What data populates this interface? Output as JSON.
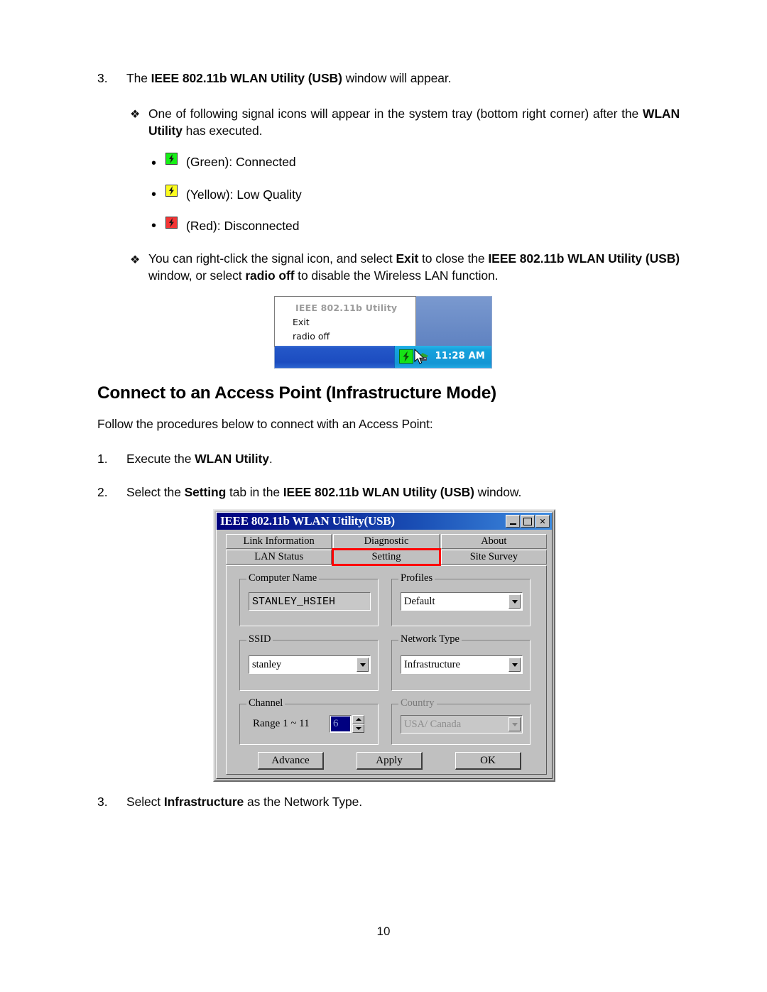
{
  "document": {
    "page_number": "10",
    "step3_top": {
      "number": "3.",
      "text_before": "The ",
      "bold": "IEEE 802.11b WLAN Utility (USB)",
      "text_after": " window will appear."
    },
    "bullet_signal_icons": {
      "marker": "❖",
      "line1_a": "One of following signal icons will appear in the system tray (bottom right corner) after the ",
      "line1_bold": "WLAN Utility",
      "line1_b": " has executed."
    },
    "signal_icons": [
      {
        "marker": "•",
        "icon": "signal-green-icon",
        "color": "#16ef16",
        "label": "(Green): Connected"
      },
      {
        "marker": "•",
        "icon": "signal-yellow-icon",
        "color": "#fcfc1e",
        "label": "(Yellow): Low Quality"
      },
      {
        "marker": "•",
        "icon": "signal-red-icon",
        "color": "#f43535",
        "label": "(Red): Disconnected"
      }
    ],
    "bullet_rightclick": {
      "marker": "❖",
      "a": "You can right-click the signal icon, and select ",
      "b1": "Exit",
      "b": " to close the ",
      "b2": "IEEE 802.11b WLAN Utility (USB)",
      "c": " window, or select ",
      "b3": "radio off",
      "d": " to disable the Wireless LAN function."
    },
    "heading": "Connect to an Access Point (Infrastructure Mode)",
    "intro": "Follow the procedures below to connect with an Access Point:",
    "steps": [
      {
        "number": "1.",
        "a": "Execute the ",
        "bold": "WLAN Utility",
        "b": "."
      },
      {
        "number": "2.",
        "a": "Select the ",
        "bold": "Setting",
        "b": " tab in the ",
        "bold2": "IEEE 802.11b WLAN Utility (USB)",
        "c": " window."
      },
      {
        "number": "3.",
        "a": "Select ",
        "bold": "Infrastructure",
        "b": " as the Network Type."
      }
    ]
  },
  "tray_screenshot": {
    "menu": {
      "title": "IEEE 802.11b Utility",
      "items": [
        "Exit",
        "radio off"
      ]
    },
    "clock": "11:28 AM",
    "taskbar_color": "#1c4cc0",
    "tray_color": "#1495d4",
    "icons": [
      "signal-green-icon",
      "network-connection-icon",
      "mouse-cursor-icon"
    ]
  },
  "wlan_dialog": {
    "title": "IEEE 802.11b WLAN Utility(USB)",
    "window_buttons": {
      "minimize": "minimize-icon",
      "maximize": "maximize-icon",
      "close": "✕"
    },
    "tabs_row1": [
      "Link Information",
      "Diagnostic",
      "About"
    ],
    "tabs_row2": [
      "LAN Status",
      "Setting",
      "Site Survey"
    ],
    "selected_tab": "Setting",
    "highlight_color": "#ff0000",
    "groups": {
      "computer_name": {
        "label": "Computer Name",
        "value": "STANLEY_HSIEH"
      },
      "profiles": {
        "label": "Profiles",
        "value": "Default"
      },
      "ssid": {
        "label": "SSID",
        "value": "stanley"
      },
      "network_type": {
        "label": "Network Type",
        "value": "Infrastructure"
      },
      "channel": {
        "label": "Channel",
        "range_label": "Range 1 ~ 11",
        "value": "6"
      },
      "country": {
        "label": "Country",
        "value": "USA/ Canada",
        "disabled": true
      }
    },
    "buttons": [
      "Advance",
      "Apply",
      "OK"
    ]
  }
}
